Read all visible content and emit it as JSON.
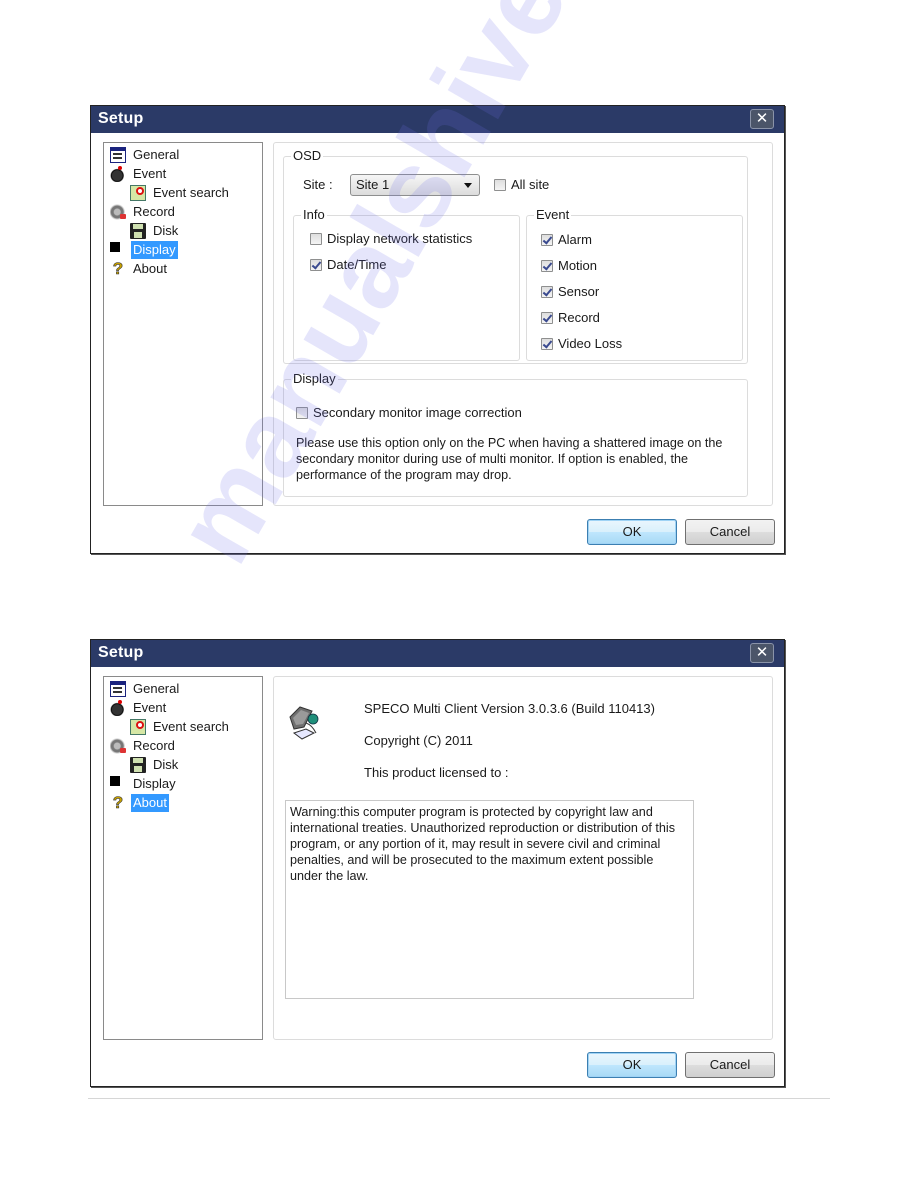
{
  "dialogs": [
    {
      "title": "Setup",
      "close_label": "✕",
      "tree": [
        {
          "label": "General",
          "icon": "general-icon",
          "selected": false
        },
        {
          "label": "Event",
          "icon": "event-bomb-icon",
          "selected": false
        },
        {
          "label": "Event search",
          "icon": "event-search-icon",
          "selected": false
        },
        {
          "label": "Record",
          "icon": "record-film-icon",
          "selected": false
        },
        {
          "label": "Disk",
          "icon": "disk-icon",
          "selected": false
        },
        {
          "label": "Display",
          "icon": "display-icon",
          "selected": true
        },
        {
          "label": "About",
          "icon": "question-icon",
          "selected": false
        }
      ],
      "osd": {
        "legend": "OSD",
        "site_label": "Site :",
        "site_value": "Site 1",
        "all_site": {
          "label": "All site",
          "checked": false
        },
        "info": {
          "legend": "Info",
          "options": [
            {
              "label": "Display network statistics",
              "checked": false
            },
            {
              "label": "Date/Time",
              "checked": true
            }
          ]
        },
        "event": {
          "legend": "Event",
          "options": [
            {
              "label": "Alarm",
              "checked": true
            },
            {
              "label": "Motion",
              "checked": true
            },
            {
              "label": "Sensor",
              "checked": true
            },
            {
              "label": "Record",
              "checked": true
            },
            {
              "label": "Video Loss",
              "checked": true
            }
          ]
        }
      },
      "display": {
        "legend": "Display",
        "option": {
          "label": "Secondary monitor image correction",
          "checked": false
        },
        "note": "Please use this option only on the PC when having a shattered image on the secondary monitor during use of multi monitor. If option is enabled, the performance of the program may drop."
      },
      "ok_label": "OK",
      "cancel_label": "Cancel"
    },
    {
      "title": "Setup",
      "close_label": "✕",
      "tree": [
        {
          "label": "General",
          "icon": "general-icon",
          "selected": false
        },
        {
          "label": "Event",
          "icon": "event-bomb-icon",
          "selected": false
        },
        {
          "label": "Event search",
          "icon": "event-search-icon",
          "selected": false
        },
        {
          "label": "Record",
          "icon": "record-film-icon",
          "selected": false
        },
        {
          "label": "Disk",
          "icon": "disk-icon",
          "selected": false
        },
        {
          "label": "Display",
          "icon": "display-icon",
          "selected": false
        },
        {
          "label": "About",
          "icon": "question-icon",
          "selected": true
        }
      ],
      "about": {
        "icon": "computer-icon",
        "version": "SPECO Multi Client Version 3.0.3.6 (Build 110413)",
        "copyright": "Copyright (C) 2011",
        "licensed_to": "This product licensed to :",
        "warning": "Warning:this computer program is protected by copyright law and international treaties. Unauthorized reproduction or distribution of this program, or any portion of it, may result in severe civil and criminal penalties, and will be prosecuted to the maximum extent possible under the law."
      },
      "ok_label": "OK",
      "cancel_label": "Cancel"
    }
  ],
  "watermark": "manualshive.com"
}
